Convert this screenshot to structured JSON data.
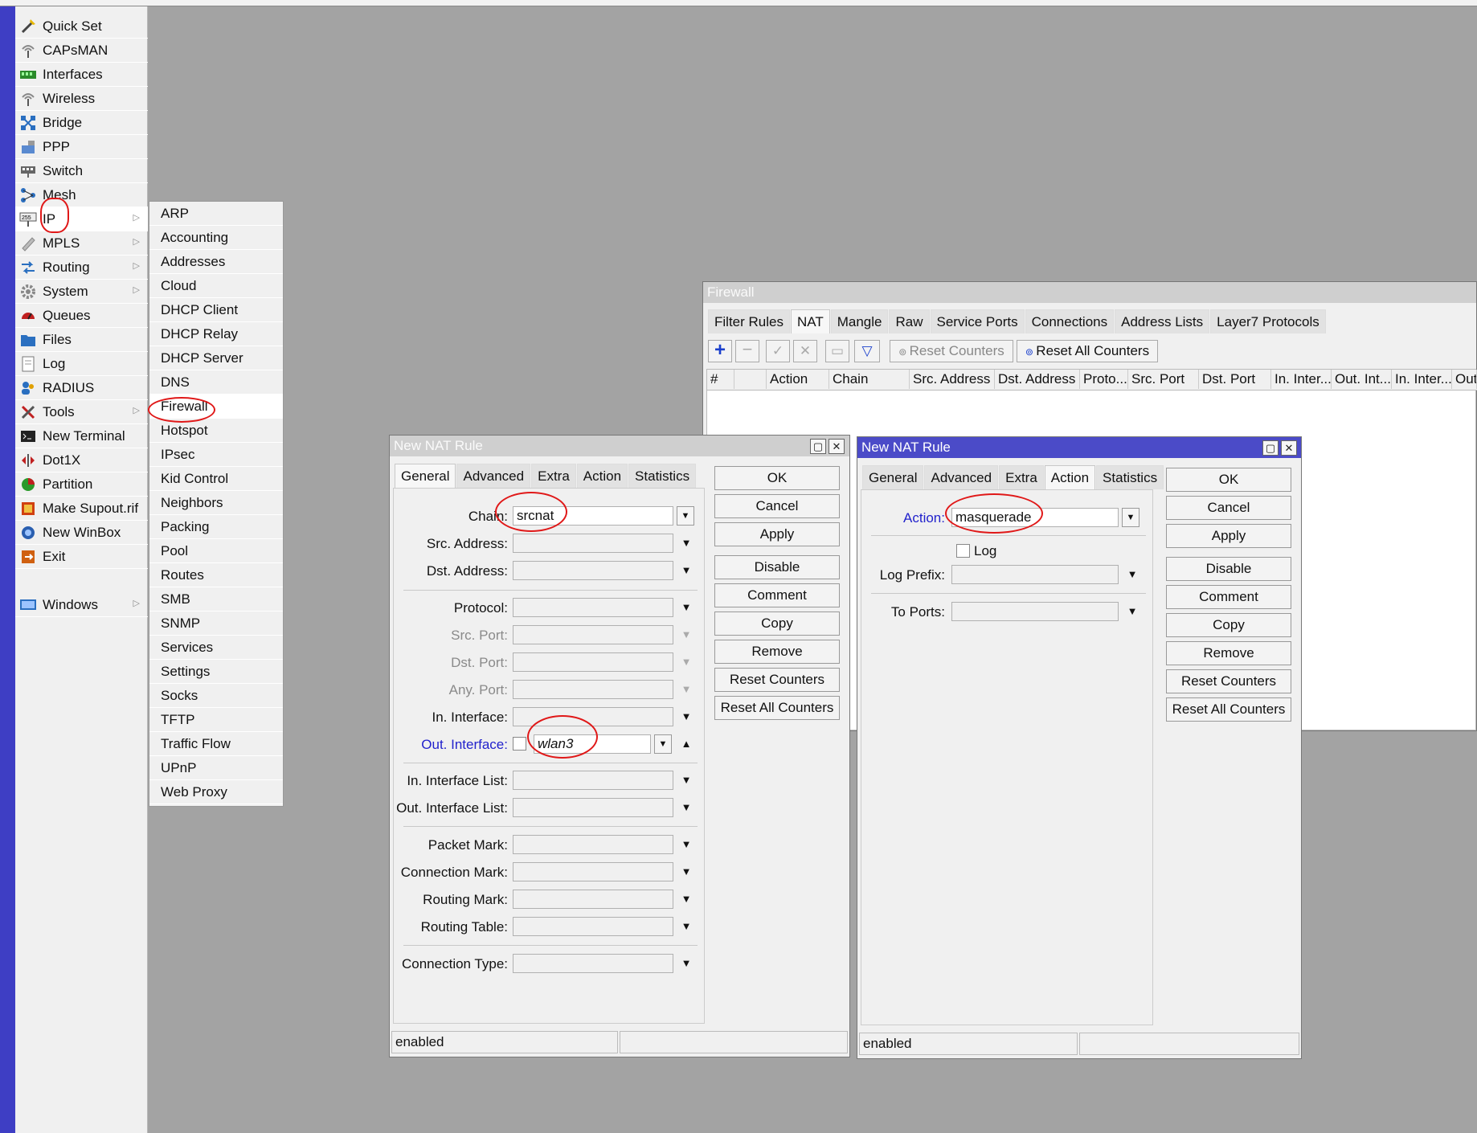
{
  "colors": {
    "menu_strip": "#3e3ec4",
    "desktop": "#a3a3a3",
    "active_title": "#4b4bc8",
    "annotation": "#e01818"
  },
  "main_menu": {
    "items": [
      {
        "label": "Quick Set",
        "icon": "wand-icon"
      },
      {
        "label": "CAPsMAN",
        "icon": "antenna-icon"
      },
      {
        "label": "Interfaces",
        "icon": "ethernet-icon"
      },
      {
        "label": "Wireless",
        "icon": "wireless-icon"
      },
      {
        "label": "Bridge",
        "icon": "bridge-icon"
      },
      {
        "label": "PPP",
        "icon": "ppp-icon"
      },
      {
        "label": "Switch",
        "icon": "switch-icon"
      },
      {
        "label": "Mesh",
        "icon": "mesh-icon"
      },
      {
        "label": "IP",
        "icon": "ip-icon"
      },
      {
        "label": "MPLS",
        "icon": "mpls-icon"
      },
      {
        "label": "Routing",
        "icon": "routing-icon"
      },
      {
        "label": "System",
        "icon": "gear-icon"
      },
      {
        "label": "Queues",
        "icon": "gauge-icon"
      },
      {
        "label": "Files",
        "icon": "folder-icon"
      },
      {
        "label": "Log",
        "icon": "document-icon"
      },
      {
        "label": "RADIUS",
        "icon": "users-icon"
      },
      {
        "label": "Tools",
        "icon": "tools-icon"
      },
      {
        "label": "New Terminal",
        "icon": "terminal-icon"
      },
      {
        "label": "Dot1X",
        "icon": "dot1x-icon"
      },
      {
        "label": "Partition",
        "icon": "pie-icon"
      },
      {
        "label": "Make Supout.rif",
        "icon": "doc-pen-icon"
      },
      {
        "label": "New WinBox",
        "icon": "winbox-icon"
      },
      {
        "label": "Exit",
        "icon": "exit-icon"
      },
      {
        "label": "Windows",
        "icon": "windows-icon"
      }
    ],
    "submenu_arrow": "▷"
  },
  "ip_submenu": {
    "items": [
      "ARP",
      "Accounting",
      "Addresses",
      "Cloud",
      "DHCP Client",
      "DHCP Relay",
      "DHCP Server",
      "DNS",
      "Firewall",
      "Hotspot",
      "IPsec",
      "Kid Control",
      "Neighbors",
      "Packing",
      "Pool",
      "Routes",
      "SMB",
      "SNMP",
      "Services",
      "Settings",
      "Socks",
      "TFTP",
      "Traffic Flow",
      "UPnP",
      "Web Proxy"
    ]
  },
  "firewall": {
    "title": "Firewall",
    "tabs": [
      "Filter Rules",
      "NAT",
      "Mangle",
      "Raw",
      "Service Ports",
      "Connections",
      "Address Lists",
      "Layer7 Protocols"
    ],
    "active_tab": "NAT",
    "toolbar": {
      "reset_counters": "Reset Counters",
      "reset_all_counters": "Reset All Counters"
    },
    "columns": [
      "#",
      "",
      "Action",
      "Chain",
      "Src. Address",
      "Dst. Address",
      "Proto...",
      "Src. Port",
      "Dst. Port",
      "In. Inter...",
      "Out. Int...",
      "In. Inter...",
      "Out."
    ]
  },
  "nat_left": {
    "title": "New NAT Rule",
    "tabs": [
      "General",
      "Advanced",
      "Extra",
      "Action",
      "Statistics"
    ],
    "active_tab": "General",
    "fields": [
      {
        "label": "Chain:",
        "value": "srcnat"
      },
      {
        "label": "Src. Address:",
        "value": ""
      },
      {
        "label": "Dst. Address:",
        "value": ""
      },
      {
        "label": "Protocol:",
        "value": ""
      },
      {
        "label": "Src. Port:",
        "value": ""
      },
      {
        "label": "Dst. Port:",
        "value": ""
      },
      {
        "label": "Any. Port:",
        "value": ""
      },
      {
        "label": "In. Interface:",
        "value": ""
      },
      {
        "label": "Out. Interface:",
        "value": "wlan3"
      },
      {
        "label": "In. Interface List:",
        "value": ""
      },
      {
        "label": "Out. Interface List:",
        "value": ""
      },
      {
        "label": "Packet Mark:",
        "value": ""
      },
      {
        "label": "Connection Mark:",
        "value": ""
      },
      {
        "label": "Routing Mark:",
        "value": ""
      },
      {
        "label": "Routing Table:",
        "value": ""
      },
      {
        "label": "Connection Type:",
        "value": ""
      }
    ],
    "buttons": [
      "OK",
      "Cancel",
      "Apply",
      "Disable",
      "Comment",
      "Copy",
      "Remove",
      "Reset Counters",
      "Reset All Counters"
    ],
    "status": "enabled"
  },
  "nat_right": {
    "title": "New NAT Rule",
    "tabs": [
      "General",
      "Advanced",
      "Extra",
      "Action",
      "Statistics"
    ],
    "active_tab": "Action",
    "action_label": "Action:",
    "action_value": "masquerade",
    "log_label": "Log",
    "log_prefix_label": "Log Prefix:",
    "to_ports_label": "To Ports:",
    "buttons": [
      "OK",
      "Cancel",
      "Apply",
      "Disable",
      "Comment",
      "Copy",
      "Remove",
      "Reset Counters",
      "Reset All Counters"
    ],
    "status": "enabled"
  }
}
